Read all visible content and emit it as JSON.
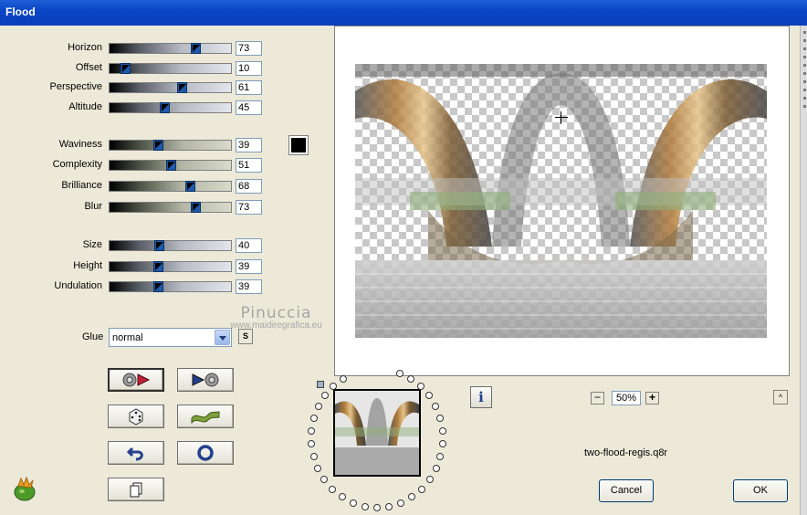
{
  "window": {
    "title": "Flood"
  },
  "sliders": [
    {
      "id": "horizon",
      "label": "Horizon",
      "value": 73,
      "max": 100,
      "group": "a"
    },
    {
      "id": "offset",
      "label": "Offset",
      "value": 10,
      "max": 100,
      "group": "a"
    },
    {
      "id": "perspective",
      "label": "Perspective",
      "value": 61,
      "max": 100,
      "group": "a"
    },
    {
      "id": "altitude",
      "label": "Altitude",
      "value": 45,
      "max": 100,
      "group": "a"
    },
    {
      "id": "waviness",
      "label": "Waviness",
      "value": 39,
      "max": 100,
      "group": "b"
    },
    {
      "id": "complexity",
      "label": "Complexity",
      "value": 51,
      "max": 100,
      "group": "b"
    },
    {
      "id": "brilliance",
      "label": "Brilliance",
      "value": 68,
      "max": 100,
      "group": "b"
    },
    {
      "id": "blur",
      "label": "Blur",
      "value": 73,
      "max": 100,
      "group": "b"
    },
    {
      "id": "size",
      "label": "Size",
      "value": 40,
      "max": 100,
      "group": "a"
    },
    {
      "id": "height",
      "label": "Height",
      "value": 39,
      "max": 100,
      "group": "a"
    },
    {
      "id": "undulation",
      "label": "Undulation",
      "value": 39,
      "max": 100,
      "group": "a"
    }
  ],
  "color": {
    "flood_color": "#000000"
  },
  "glue": {
    "label": "Glue",
    "value": "normal",
    "s_label": "S"
  },
  "watermark": {
    "name": "Pinuccia",
    "site": "www.maidiregrafica.eu"
  },
  "zoom": {
    "value": "50%",
    "minus": "−",
    "plus": "+"
  },
  "info": {
    "label": "i"
  },
  "collapse": {
    "label": "^"
  },
  "filename": "two-flood-regis.q8r",
  "buttons": {
    "cancel": "Cancel",
    "ok": "OK"
  },
  "icons": [
    "record-icon",
    "play-forward-icon",
    "dice-icon",
    "wave-icon",
    "undo-icon",
    "reset-icon",
    "page-icon",
    "plugin-logo-icon"
  ]
}
